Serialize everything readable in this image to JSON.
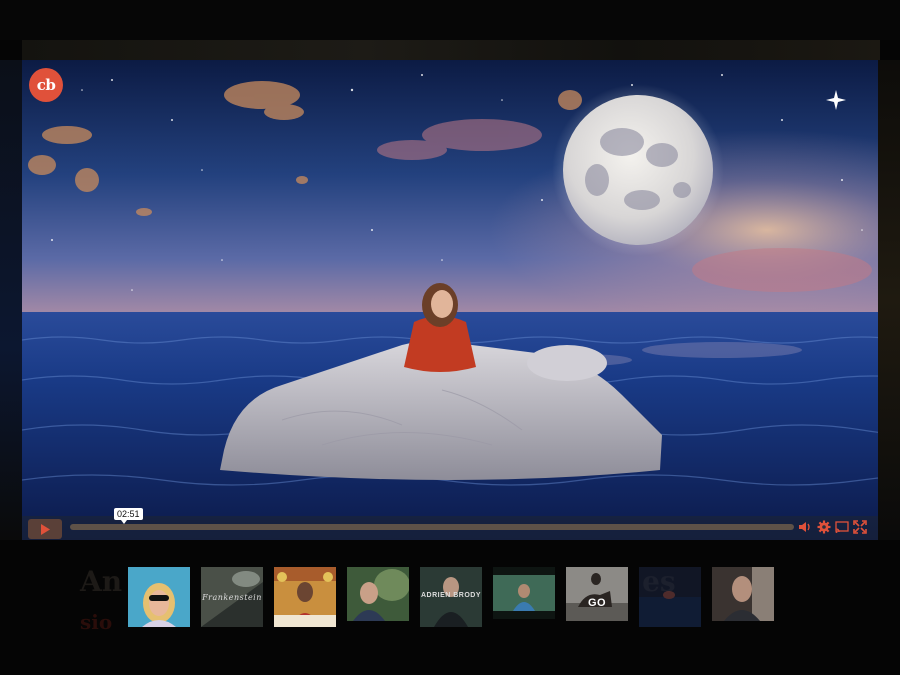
{
  "brand": {
    "logo_text": "cb",
    "accent_color": "#e0513a"
  },
  "player": {
    "time_tooltip": "02:51",
    "progress_fraction": 0.0,
    "controls": [
      "play-icon",
      "volume-icon",
      "gear-icon",
      "cast-icon",
      "fullscreen-icon"
    ]
  },
  "background_page": {
    "title_partial": "An",
    "title_partial_right": "es",
    "subtitle_partial": "sio"
  },
  "thumbnails": [
    {
      "name": "thumb-1"
    },
    {
      "name": "thumb-2",
      "label": "Frankenstein"
    },
    {
      "name": "thumb-3"
    },
    {
      "name": "thumb-4"
    },
    {
      "name": "thumb-5",
      "label": "ADRIEN BRODY"
    },
    {
      "name": "thumb-6"
    },
    {
      "name": "thumb-7",
      "label": "GO"
    },
    {
      "name": "thumb-8"
    },
    {
      "name": "thumb-9"
    }
  ]
}
